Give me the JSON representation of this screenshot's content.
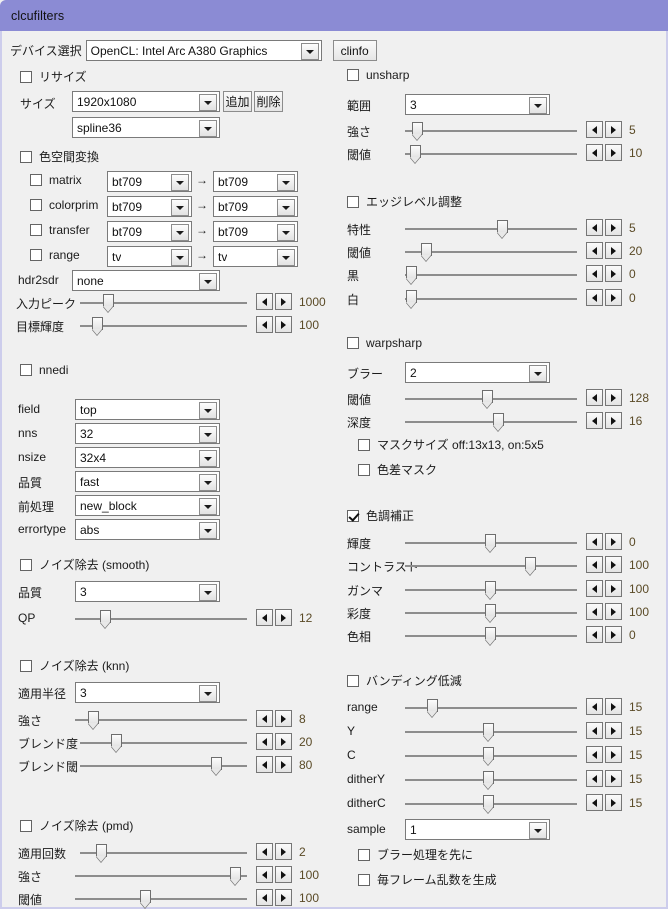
{
  "window": {
    "title": "clcufilters",
    "title_bar_color": "#8b8bd4",
    "background": "#f0f0f0"
  },
  "device": {
    "label": "デバイス選択",
    "combo_value": "OpenCL: Intel Arc A380 Graphics",
    "clinfo_button": "clinfo"
  },
  "left": {
    "resize": {
      "checkbox_label": "リサイズ",
      "checked": false,
      "size_label": "サイズ",
      "size_value": "1920x1080",
      "algo_value": "spline36",
      "add_button": "追加",
      "del_button": "削除"
    },
    "colorspace": {
      "checkbox_label": "色空間変換",
      "checked": false,
      "arrow": "→",
      "rows": [
        {
          "name": "matrix",
          "checked": false,
          "from": "bt709",
          "to": "bt709"
        },
        {
          "name": "colorprim",
          "checked": false,
          "from": "bt709",
          "to": "bt709"
        },
        {
          "name": "transfer",
          "checked": false,
          "from": "bt709",
          "to": "bt709"
        },
        {
          "name": "range",
          "checked": false,
          "from": "tv",
          "to": "tv"
        }
      ],
      "hdr2sdr_label": "hdr2sdr",
      "hdr2sdr_value": "none",
      "sliders": [
        {
          "label": "入力ピーク",
          "value": "1000",
          "pos": 0.175
        },
        {
          "label": "目標輝度",
          "value": "100",
          "pos": 0.095
        }
      ]
    },
    "nnedi": {
      "checkbox_label": "nnedi",
      "checked": false,
      "combos": [
        {
          "label": "field",
          "value": "top"
        },
        {
          "label": "nns",
          "value": "32"
        },
        {
          "label": "nsize",
          "value": "32x4"
        },
        {
          "label": "品質",
          "value": "fast"
        },
        {
          "label": "前処理",
          "value": "new_block"
        },
        {
          "label": "errortype",
          "value": "abs"
        }
      ]
    },
    "denoise_smooth": {
      "checkbox_label": "ノイズ除去 (smooth)",
      "checked": false,
      "quality_label": "品質",
      "quality_value": "3",
      "sliders": [
        {
          "label": "QP",
          "value": "12",
          "pos": 0.155
        }
      ]
    },
    "denoise_knn": {
      "checkbox_label": "ノイズ除去 (knn)",
      "checked": false,
      "radius_label": "適用半径",
      "radius_value": "3",
      "sliders": [
        {
          "label": "強さ",
          "value": "8",
          "pos": 0.085
        },
        {
          "label": "ブレンド度",
          "value": "20",
          "pos": 0.195
        },
        {
          "label": "ブレンド閾",
          "value": "80",
          "pos": 0.795
        }
      ]
    },
    "denoise_pmd": {
      "checkbox_label": "ノイズ除去 (pmd)",
      "checked": false,
      "sliders": [
        {
          "label": "適用回数",
          "value": "2",
          "pos": 0.115
        },
        {
          "label": "強さ",
          "value": "100",
          "pos": 0.965
        },
        {
          "label": "閾値",
          "value": "100",
          "pos": 0.405
        }
      ]
    }
  },
  "right": {
    "unsharp": {
      "checkbox_label": "unsharp",
      "checked": false,
      "range_label": "範囲",
      "range_value": "3",
      "sliders": [
        {
          "label": "強さ",
          "value": "5",
          "pos": 0.045
        },
        {
          "label": "閾値",
          "value": "10",
          "pos": 0.035
        }
      ]
    },
    "edgelevel": {
      "checkbox_label": "エッジレベル調整",
      "checked": false,
      "sliders": [
        {
          "label": "特性",
          "value": "5",
          "pos": 0.565
        },
        {
          "label": "閾値",
          "value": "20",
          "pos": 0.105
        },
        {
          "label": "黒",
          "value": "0",
          "pos": 0.015
        },
        {
          "label": "白",
          "value": "0",
          "pos": 0.015
        }
      ]
    },
    "warpsharp": {
      "checkbox_label": "warpsharp",
      "checked": false,
      "blur_label": "ブラー",
      "blur_value": "2",
      "sliders": [
        {
          "label": "閾値",
          "value": "128",
          "pos": 0.475
        },
        {
          "label": "深度",
          "value": "16",
          "pos": 0.545
        }
      ],
      "mask_size_label": "マスクサイズ off:13x13, on:5x5",
      "mask_size_checked": false,
      "chroma_mask_label": "色差マスク",
      "chroma_mask_checked": false
    },
    "tweak": {
      "checkbox_label": "色調補正",
      "checked": true,
      "sliders": [
        {
          "label": "輝度",
          "value": "0",
          "pos": 0.495
        },
        {
          "label": "コントラスト",
          "value": "100",
          "pos": 0.725
        },
        {
          "label": "ガンマ",
          "value": "100",
          "pos": 0.495
        },
        {
          "label": "彩度",
          "value": "100",
          "pos": 0.495
        },
        {
          "label": "色相",
          "value": "0",
          "pos": 0.495
        }
      ]
    },
    "deband": {
      "checkbox_label": "バンディング低減",
      "checked": false,
      "sliders": [
        {
          "label": "range",
          "value": "15",
          "pos": 0.135
        },
        {
          "label": "Y",
          "value": "15",
          "pos": 0.485
        },
        {
          "label": "C",
          "value": "15",
          "pos": 0.485
        },
        {
          "label": "ditherY",
          "value": "15",
          "pos": 0.485
        },
        {
          "label": "ditherC",
          "value": "15",
          "pos": 0.485
        }
      ],
      "sample_label": "sample",
      "sample_value": "1",
      "blur_first_label": "ブラー処理を先に",
      "blur_first_checked": false,
      "rand_each_frame_label": "毎フレーム乱数を生成",
      "rand_each_frame_checked": false
    }
  }
}
